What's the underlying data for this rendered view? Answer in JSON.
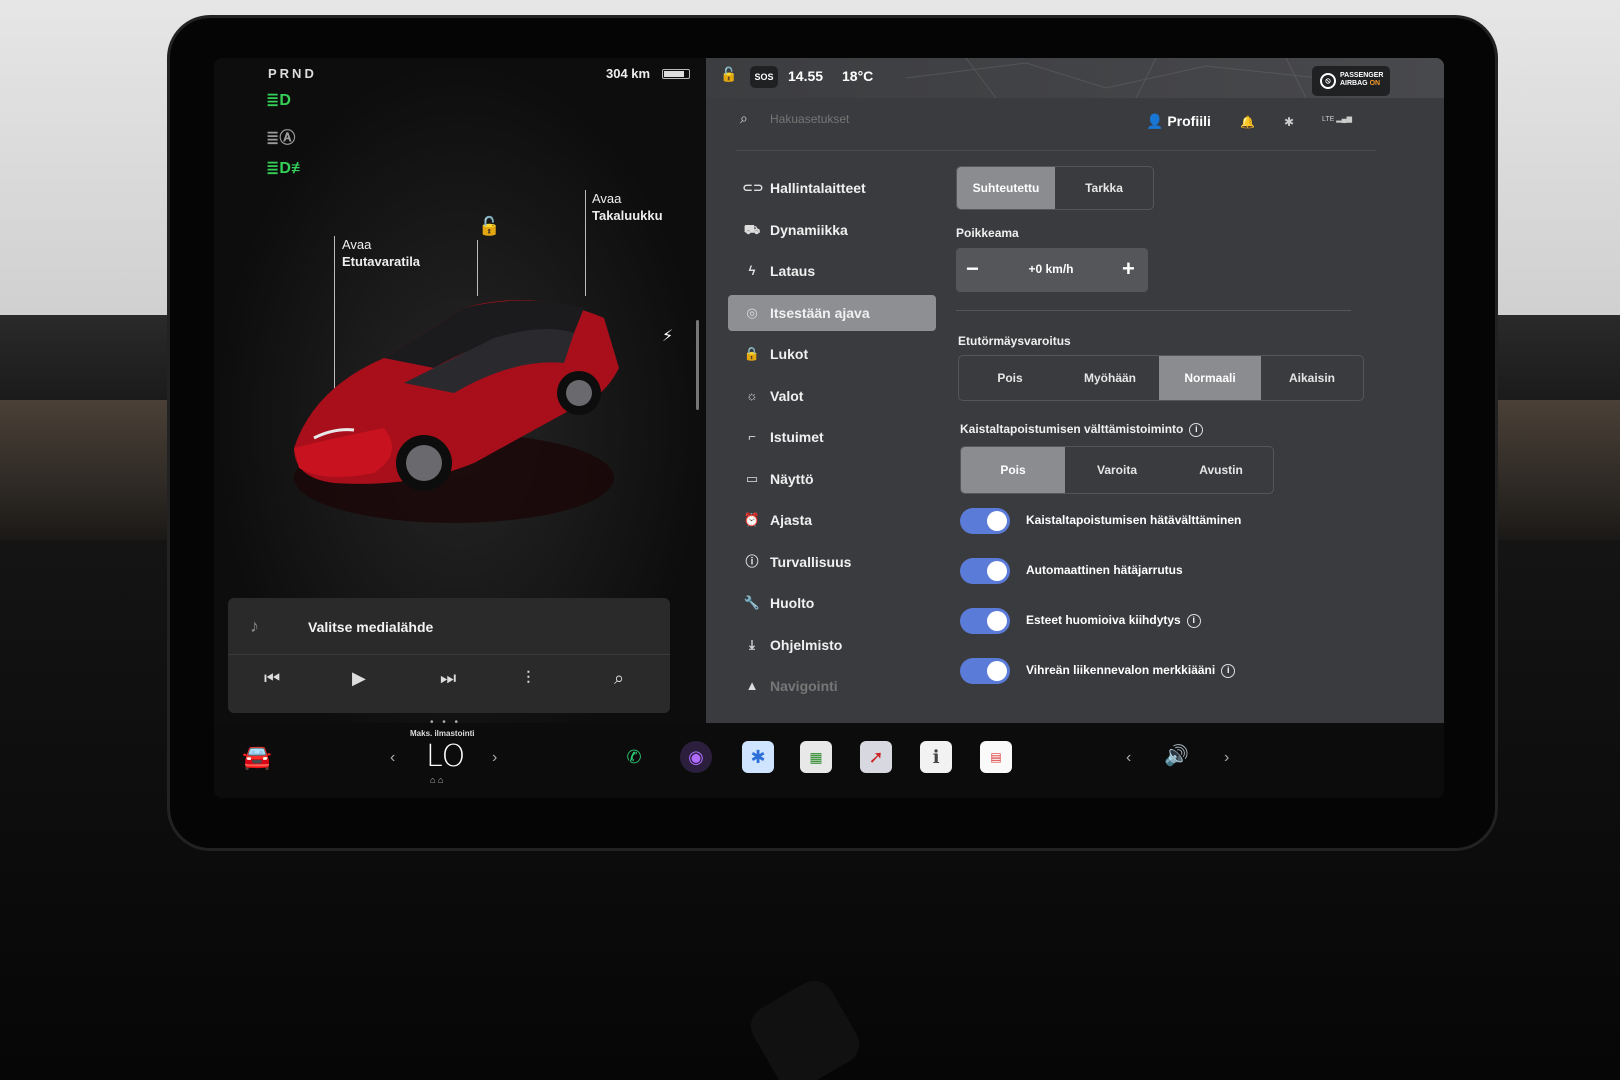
{
  "vehicle_panel": {
    "gear": "PRND",
    "range": "304 km",
    "battery_level": 0.75,
    "callouts": {
      "frunk": {
        "line1": "Avaa",
        "line2": "Etutavaratila"
      },
      "trunk": {
        "line1": "Avaa",
        "line2": "Takaluukku"
      }
    },
    "indicator_colors": {
      "headlights": "#34d058",
      "auto_lights": "#9a9a9a",
      "fog_lights": "#34d058"
    }
  },
  "media": {
    "title": "Valitse medialähde",
    "controls": [
      "previous-icon",
      "play-icon",
      "next-icon",
      "equalizer-icon",
      "search-icon"
    ]
  },
  "status_bar": {
    "sos": "SOS",
    "time": "14.55",
    "temperature": "18°C",
    "airbag_line1": "PASSENGER",
    "airbag_line2": "AIRBAG",
    "airbag_state": "ON",
    "airbag_on_color": "#f39b2b"
  },
  "header": {
    "search_placeholder": "Hakuasetukset",
    "profile": "Profiili",
    "lte": "LTE"
  },
  "nav": {
    "items": [
      {
        "label": "Hallintalaitteet",
        "icon": "toggle-icon"
      },
      {
        "label": "Dynamiikka",
        "icon": "car-icon"
      },
      {
        "label": "Lataus",
        "icon": "bolt-icon"
      },
      {
        "label": "Itsestään ajava",
        "icon": "steering-wheel-icon",
        "active": true
      },
      {
        "label": "Lukot",
        "icon": "lock-icon"
      },
      {
        "label": "Valot",
        "icon": "sun-icon"
      },
      {
        "label": "Istuimet",
        "icon": "seat-icon"
      },
      {
        "label": "Näyttö",
        "icon": "display-icon"
      },
      {
        "label": "Ajasta",
        "icon": "alarm-icon"
      },
      {
        "label": "Turvallisuus",
        "icon": "info-icon"
      },
      {
        "label": "Huolto",
        "icon": "wrench-icon"
      },
      {
        "label": "Ohjelmisto",
        "icon": "download-icon"
      },
      {
        "label": "Navigointi",
        "icon": "navigation-icon"
      }
    ]
  },
  "settings": {
    "speed_mode": {
      "options": [
        "Suhteutettu",
        "Tarkka"
      ],
      "selected": "Suhteutettu"
    },
    "offset": {
      "label": "Poikkeama",
      "value": "+0 km/h",
      "minus": "−",
      "plus": "+"
    },
    "collision_warning": {
      "label": "Etutörmäysvaroitus",
      "options": [
        "Pois",
        "Myöhään",
        "Normaali",
        "Aikaisin"
      ],
      "selected": "Normaali"
    },
    "lane_departure": {
      "label": "Kaistaltapoistumisen välttämistoiminto",
      "options": [
        "Pois",
        "Varoita",
        "Avustin"
      ],
      "selected": "Pois"
    },
    "toggles": [
      {
        "label": "Kaistaltapoistumisen hätävälttäminen",
        "on": true,
        "info": false
      },
      {
        "label": "Automaattinen hätäjarrutus",
        "on": true,
        "info": false
      },
      {
        "label": "Esteet huomioiva kiihdytys",
        "on": true,
        "info": true
      },
      {
        "label": "Vihreän liikennevalon merkkiääni",
        "on": true,
        "info": true
      }
    ],
    "toggle_color": "#5a7bd8"
  },
  "dock": {
    "climate_label": "Maks. ilmastointi",
    "climate_value": "LO",
    "apps": [
      "phone-icon",
      "camera-icon",
      "bluetooth-icon",
      "toybox-icon",
      "navigation-app-icon",
      "manual-icon",
      "calendar-icon"
    ],
    "volume_icon": "volume-icon"
  }
}
